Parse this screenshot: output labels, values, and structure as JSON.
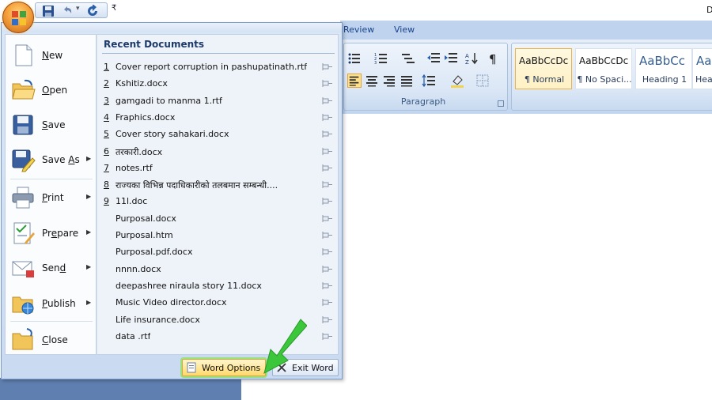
{
  "title_fragment": "D",
  "quick_access": {
    "dropdown_glyph": "₹"
  },
  "ribbon": {
    "tabs": [
      "Review",
      "View"
    ],
    "paragraph_label": "Paragraph",
    "styles": [
      {
        "sample": "AaBbCcDc",
        "name": "¶ Normal",
        "active": true
      },
      {
        "sample": "AaBbCcDc",
        "name": "¶ No Spaci...",
        "active": false
      },
      {
        "sample": "AaBbCc",
        "name": "Heading 1",
        "active": false
      },
      {
        "sample": "AaI",
        "name": "Hea",
        "active": false
      }
    ]
  },
  "office_menu": {
    "commands": [
      {
        "label": "New",
        "icon": "new-document-icon",
        "submenu": false
      },
      {
        "label": "Open",
        "icon": "open-folder-icon",
        "submenu": false
      },
      {
        "label": "Save",
        "icon": "save-disk-icon",
        "submenu": false
      },
      {
        "label": "Save As",
        "icon": "save-as-icon",
        "submenu": true
      },
      {
        "label": "Print",
        "icon": "printer-icon",
        "submenu": true
      },
      {
        "label": "Prepare",
        "icon": "prepare-icon",
        "submenu": true
      },
      {
        "label": "Send",
        "icon": "send-icon",
        "submenu": true
      },
      {
        "label": "Publish",
        "icon": "publish-icon",
        "submenu": true
      },
      {
        "label": "Close",
        "icon": "close-folder-icon",
        "submenu": false
      }
    ],
    "recent_title": "Recent Documents",
    "recent_documents": [
      {
        "num": "1",
        "name": "Cover report corruption in pashupatinath.rtf"
      },
      {
        "num": "2",
        "name": "Kshitiz.docx"
      },
      {
        "num": "3",
        "name": "gamgadi to manma 1.rtf"
      },
      {
        "num": "4",
        "name": "Fraphics.docx"
      },
      {
        "num": "5",
        "name": "Cover story sahakari.docx"
      },
      {
        "num": "6",
        "name": "तरकारी.docx"
      },
      {
        "num": "7",
        "name": "notes.rtf"
      },
      {
        "num": "8",
        "name": "राज्यका विभिन्न  पदाधिकारीको तलबमान सम्बन्धी...."
      },
      {
        "num": "9",
        "name": "11l.doc"
      },
      {
        "num": "",
        "name": "Purposal.docx"
      },
      {
        "num": "",
        "name": "Purposal.htm"
      },
      {
        "num": "",
        "name": "Purposal.pdf.docx"
      },
      {
        "num": "",
        "name": "nnnn.docx"
      },
      {
        "num": "",
        "name": "deepashree niraula story 11.docx"
      },
      {
        "num": "",
        "name": "Music Video director.docx"
      },
      {
        "num": "",
        "name": "Life insurance.docx"
      },
      {
        "num": "",
        "name": "data .rtf"
      }
    ],
    "word_options_label": "Word Options",
    "exit_word_label": "Exit Word"
  },
  "colors": {
    "highlight_arrow": "#3cc63c",
    "menu_border": "#7b9bc8",
    "title_text": "#1d3a6b"
  }
}
